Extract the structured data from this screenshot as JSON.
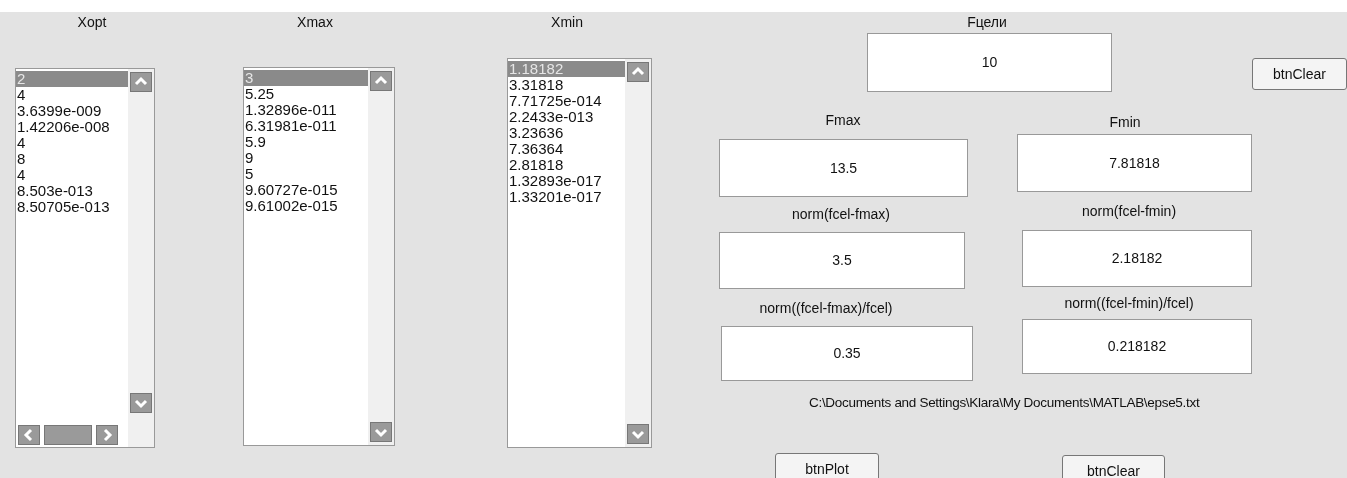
{
  "lists": [
    {
      "label": "Xopt",
      "horizontal_scrollbar": true,
      "items": [
        {
          "text": "2",
          "selected": true
        },
        {
          "text": "4",
          "selected": false
        },
        {
          "text": "3.6399e-009",
          "selected": false
        },
        {
          "text": "1.42206e-008",
          "selected": false
        },
        {
          "text": "4",
          "selected": false
        },
        {
          "text": "8",
          "selected": false
        },
        {
          "text": "4",
          "selected": false
        },
        {
          "text": "8.503e-013",
          "selected": false
        },
        {
          "text": "8.50705e-013",
          "selected": false
        }
      ]
    },
    {
      "label": "Xmax",
      "horizontal_scrollbar": false,
      "items": [
        {
          "text": "3",
          "selected": true
        },
        {
          "text": "5.25",
          "selected": false
        },
        {
          "text": "1.32896e-011",
          "selected": false
        },
        {
          "text": "6.31981e-011",
          "selected": false
        },
        {
          "text": "5.9",
          "selected": false
        },
        {
          "text": "9",
          "selected": false
        },
        {
          "text": "5",
          "selected": false
        },
        {
          "text": "9.60727e-015",
          "selected": false
        },
        {
          "text": "9.61002e-015",
          "selected": false
        }
      ]
    },
    {
      "label": "Xmin",
      "horizontal_scrollbar": false,
      "items": [
        {
          "text": "1.18182",
          "selected": true
        },
        {
          "text": "3.31818",
          "selected": false
        },
        {
          "text": "7.71725e-014",
          "selected": false
        },
        {
          "text": "2.2433e-013",
          "selected": false
        },
        {
          "text": "3.23636",
          "selected": false
        },
        {
          "text": "7.36364",
          "selected": false
        },
        {
          "text": "2.81818",
          "selected": false
        },
        {
          "text": "1.32893e-017",
          "selected": false
        },
        {
          "text": "1.33201e-017",
          "selected": false
        }
      ]
    }
  ],
  "fields": [
    {
      "label": "Fцели",
      "value": "10"
    },
    {
      "label": "Fmax",
      "value": "13.5"
    },
    {
      "label": "Fmin",
      "value": "7.81818"
    },
    {
      "label": "norm(fcel-fmax)",
      "value": "3.5"
    },
    {
      "label": "norm(fcel-fmin)",
      "value": "2.18182"
    },
    {
      "label": "norm((fcel-fmax)/fcel)",
      "value": "0.35"
    },
    {
      "label": "norm((fcel-fmin)/fcel)",
      "value": "0.218182"
    }
  ],
  "file_path": "C:\\Documents and Settings\\Klara\\My Documents\\MATLAB\\epse5.txt",
  "buttons": [
    "btnClear",
    "btnPlot",
    "btnClear"
  ]
}
